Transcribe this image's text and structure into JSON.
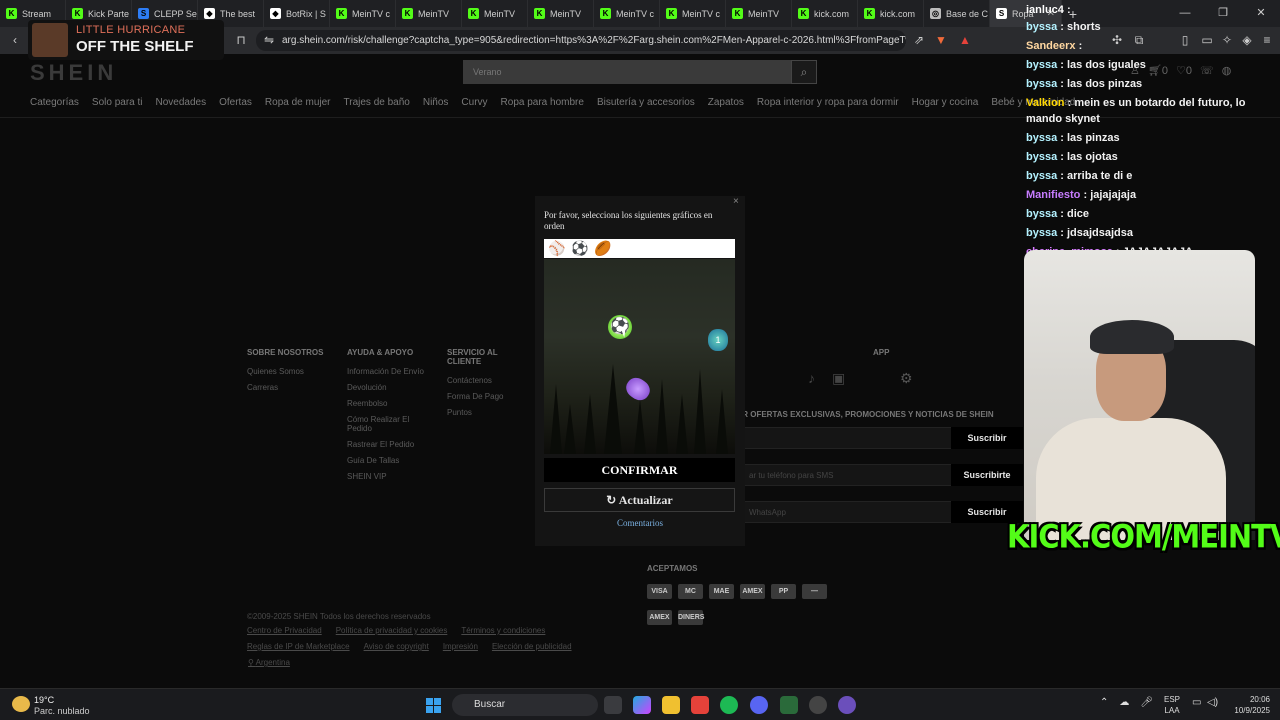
{
  "browser": {
    "tabs": [
      {
        "label": "Stream",
        "color": "#53fc18",
        "glyph": "K"
      },
      {
        "label": "Kick Parte",
        "color": "#53fc18",
        "glyph": "K"
      },
      {
        "label": "CLEPP Se",
        "color": "#2d7df6",
        "glyph": "S"
      },
      {
        "label": "The best",
        "color": "#ffffff",
        "glyph": "◆"
      },
      {
        "label": "BotRix | S",
        "color": "#ffffff",
        "glyph": "◆"
      },
      {
        "label": "MeinTV c",
        "color": "#53fc18",
        "glyph": "K"
      },
      {
        "label": "MeinTV",
        "color": "#53fc18",
        "glyph": "K"
      },
      {
        "label": "MeinTV",
        "color": "#53fc18",
        "glyph": "K"
      },
      {
        "label": "MeinTV",
        "color": "#53fc18",
        "glyph": "K"
      },
      {
        "label": "MeinTV c",
        "color": "#53fc18",
        "glyph": "K"
      },
      {
        "label": "MeinTV c",
        "color": "#53fc18",
        "glyph": "K"
      },
      {
        "label": "MeinTV",
        "color": "#53fc18",
        "glyph": "K"
      },
      {
        "label": "kick.com",
        "color": "#53fc18",
        "glyph": "K"
      },
      {
        "label": "kick.com",
        "color": "#53fc18",
        "glyph": "K"
      },
      {
        "label": "Base de C",
        "color": "#bbbbbb",
        "glyph": "◎"
      },
      {
        "label": "Ropa",
        "color": "#ffffff",
        "glyph": "S",
        "active": true
      }
    ],
    "url": "arg.shein.com/risk/challenge?captcha_type=905&redirection=https%3A%2F%2Farg.shein.com%2FMen-Apparel-c-2026.html%3FfromPageType%3Dh...",
    "badge_count": "4"
  },
  "stream_overlay": {
    "artist": "LITTLE HURRICANE",
    "song": "OFF THE SHELF"
  },
  "shein": {
    "logo": "SHEIN",
    "search_placeholder": "Verano",
    "cart_count": "0",
    "wish_count": "0",
    "nav": [
      "Categorías",
      "Solo para ti",
      "Novedades",
      "Ofertas",
      "Ropa de mujer",
      "Trajes de baño",
      "Niños",
      "Curvy",
      "Ropa para hombre",
      "Bisutería y accesorios",
      "Zapatos",
      "Ropa interior y ropa para dormir",
      "Hogar y cocina",
      "Bebé y maternidad"
    ],
    "footer": {
      "col1": {
        "title": "SOBRE NOSOTROS",
        "items": [
          "Quienes Somos",
          "Carreras"
        ]
      },
      "col2": {
        "title": "AYUDA & APOYO",
        "items": [
          "Información De Envío",
          "Devolución",
          "Reembolso",
          "Cómo Realizar El Pedido",
          "Rastrear El Pedido",
          "Guía De Tallas",
          "SHEIN VIP"
        ]
      },
      "col3": {
        "title": "SERVICIO AL CLIENTE",
        "items": [
          "Contáctenos",
          "Forma De Pago",
          "Puntos"
        ]
      },
      "app_title": "APP",
      "subscribe_text": "IR OFERTAS EXCLUSIVAS, PROMOCIONES Y NOTICIAS DE SHEIN",
      "subscribe_btn": "Suscribir",
      "subscribe_sms_ph": "ar tu teléfono para SMS",
      "subscribe_sms_btn": "Suscribirte",
      "subscribe_wa_ph": "WhatsApp",
      "subscribe_wa_btn": "Suscribir",
      "accept_title": "ACEPTAMOS",
      "cards": [
        "VISA",
        "MC",
        "MAE",
        "AMEX",
        "PP",
        "—",
        "AMEX",
        "DINERS"
      ],
      "copyright": "©2009-2025 SHEIN Todos los derechos reservados",
      "legal1": [
        "Centro de Privacidad",
        "Política de privacidad y cookies",
        "Términos y condiciones"
      ],
      "legal2": [
        "Reglas de IP de Marketplace",
        "Aviso de copyright",
        "Impresión",
        "Elección de publicidad"
      ],
      "country": "Argentina"
    }
  },
  "captcha": {
    "instruction": "Por favor, selecciona los siguientes gráficos en orden",
    "strip_icons": [
      "⚾",
      "⚽",
      "🏉"
    ],
    "marker": "1",
    "confirm": "CONFIRMAR",
    "refresh": "Actualizar",
    "refresh_icon": "↻",
    "feedback": "Comentarios"
  },
  "chat": [
    {
      "user": "ianluc4",
      "text": "",
      "color": "#ffffff"
    },
    {
      "user": "byssa",
      "text": "shorts",
      "color": "#b4f2ff"
    },
    {
      "user": "Sandeerx",
      "text": "",
      "color": "#ffd7a0"
    },
    {
      "user": "byssa",
      "text": "las dos iguales",
      "color": "#b4f2ff"
    },
    {
      "user": "byssa",
      "text": "las dos pinzas",
      "color": "#b4f2ff"
    },
    {
      "user": "Valkion",
      "text": "mein es un botardo del futuro, lo mando skynet",
      "color": "#ffd700"
    },
    {
      "user": "byssa",
      "text": "las pinzas",
      "color": "#b4f2ff"
    },
    {
      "user": "byssa",
      "text": "las ojotas",
      "color": "#b4f2ff"
    },
    {
      "user": "byssa",
      "text": "arriba te di e",
      "color": "#b4f2ff"
    },
    {
      "user": "Manifiesto",
      "text": "jajajajaja",
      "color": "#c77dff"
    },
    {
      "user": "byssa",
      "text": "dice",
      "color": "#b4f2ff"
    },
    {
      "user": "byssa",
      "text": "jdsajdsajdsa",
      "color": "#b4f2ff"
    },
    {
      "user": "cherine_mimosa",
      "text": "JAJAJAJAJA",
      "color": "#d77dff"
    }
  ],
  "kick_banner": "KICK.COM/MEINTV",
  "taskbar": {
    "temp": "19°C",
    "weather": "Parc. nublado",
    "search": "Buscar",
    "lang1": "ESP",
    "lang2": "LAA",
    "time": "20:06",
    "date": "10/9/2025"
  },
  "colors": {
    "kick_green": "#53fc18",
    "link_blue": "#7ab0e0"
  }
}
